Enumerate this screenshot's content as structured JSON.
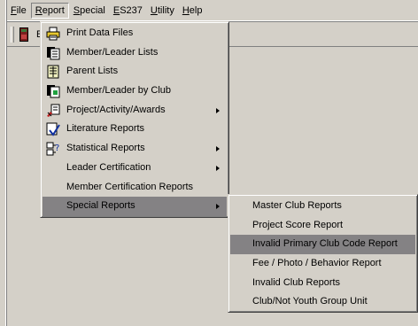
{
  "menubar": {
    "items": [
      {
        "label": "File",
        "ul": "F",
        "rest": "ile"
      },
      {
        "label": "Report",
        "ul": "R",
        "rest": "eport"
      },
      {
        "label": "Special",
        "ul": "S",
        "rest": "pecial"
      },
      {
        "label": "ES237",
        "ul": "E",
        "rest": "S237"
      },
      {
        "label": "Utility",
        "ul": "U",
        "rest": "tility"
      },
      {
        "label": "Help",
        "ul": "H",
        "rest": "elp"
      }
    ]
  },
  "toolbar": {
    "partial_label": "E"
  },
  "report_menu": {
    "items": [
      {
        "label": "Print Data Files",
        "icon": "printer-icon"
      },
      {
        "label": "Member/Leader Lists",
        "icon": "pages-icon"
      },
      {
        "label": "Parent Lists",
        "icon": "document-icon"
      },
      {
        "label": "Member/Leader by Club",
        "icon": "club-document-icon"
      },
      {
        "label": "Project/Activity/Awards",
        "icon": "award-document-icon"
      },
      {
        "label": "Literature Reports",
        "icon": "checkmark-document-icon"
      },
      {
        "label": "Statistical Reports",
        "icon": "statistics-icon"
      },
      {
        "label": "Leader Certification"
      },
      {
        "label": "Member Certification Reports"
      },
      {
        "label": "Special Reports"
      }
    ]
  },
  "special_reports_menu": {
    "items": [
      {
        "label": "Master Club Reports"
      },
      {
        "label": "Project Score Report"
      },
      {
        "label": "Invalid Primary Club Code Report"
      },
      {
        "label": "Fee / Photo / Behavior Report"
      },
      {
        "label": "Invalid Club Reports"
      },
      {
        "label": "Club/Not Youth Group Unit"
      }
    ]
  },
  "colors": {
    "face": "#d4d0c8",
    "highlight": "#848284",
    "shadow": "#808080"
  }
}
